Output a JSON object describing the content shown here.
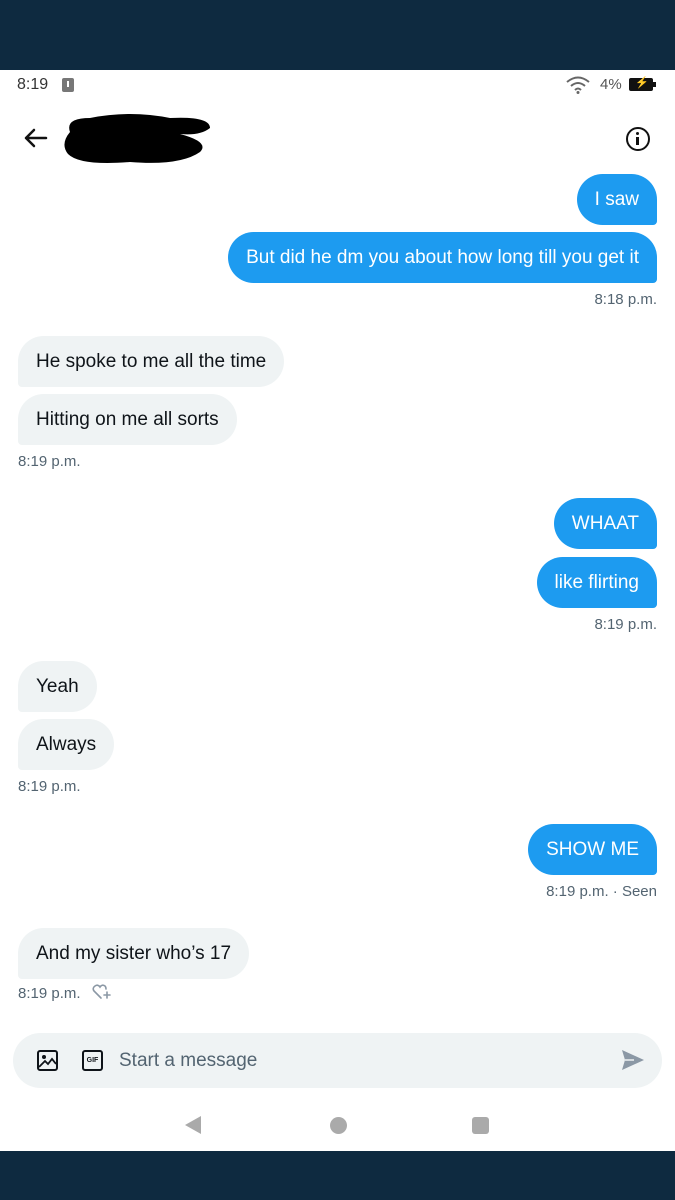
{
  "status_bar": {
    "time": "8:19",
    "battery_percent": "4%"
  },
  "header": {
    "contact_name_redacted": true
  },
  "messages": [
    {
      "text": "I saw",
      "direction": "out"
    },
    {
      "text": "But did he dm you about how long till you get it",
      "direction": "out"
    },
    {
      "timestamp": "8:18 p.m.",
      "direction": "out"
    },
    {
      "text": "He spoke to me all the time",
      "direction": "in"
    },
    {
      "text": "Hitting on me all sorts",
      "direction": "in"
    },
    {
      "timestamp": "8:19 p.m.",
      "direction": "in"
    },
    {
      "text": "WHAAT",
      "direction": "out"
    },
    {
      "text": "like flirting",
      "direction": "out"
    },
    {
      "timestamp": "8:19 p.m.",
      "direction": "out"
    },
    {
      "text": "Yeah",
      "direction": "in"
    },
    {
      "text": "Always",
      "direction": "in"
    },
    {
      "timestamp": "8:19 p.m.",
      "direction": "in"
    },
    {
      "text": "SHOW ME",
      "direction": "out"
    },
    {
      "timestamp": "8:19 p.m. · Seen",
      "direction": "out"
    },
    {
      "text": "And my sister who’s 17",
      "direction": "in"
    },
    {
      "timestamp": "8:19 p.m.",
      "direction": "in"
    }
  ],
  "composer": {
    "placeholder": "Start a message"
  },
  "colors": {
    "outgoing_bubble": "#1d9bf0",
    "incoming_bubble": "#eff3f4",
    "frame": "#0e2a40"
  }
}
